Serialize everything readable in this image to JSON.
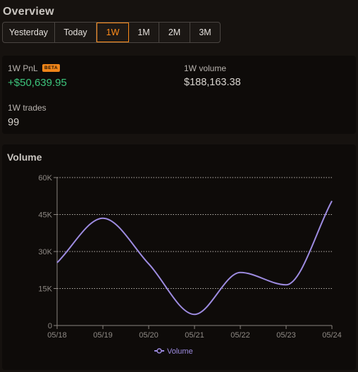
{
  "overview": {
    "title": "Overview",
    "tabs": [
      {
        "label": "Yesterday",
        "active": false
      },
      {
        "label": "Today",
        "active": false
      },
      {
        "label": "1W",
        "active": true
      },
      {
        "label": "1M",
        "active": false
      },
      {
        "label": "2M",
        "active": false
      },
      {
        "label": "3M",
        "active": false
      }
    ]
  },
  "stats": {
    "pnl_label": "1W PnL",
    "pnl_badge": "BETA",
    "pnl_value": "+$50,639.95",
    "volume_label": "1W volume",
    "volume_value": "$188,163.38",
    "trades_label": "1W trades",
    "trades_value": "99"
  },
  "colors": {
    "accent": "#ff8c1a",
    "positive": "#3cc47c",
    "series": "#9d8be0"
  },
  "chart_data": {
    "type": "line",
    "title": "Volume",
    "x": [
      "05/18",
      "05/19",
      "05/20",
      "05/21",
      "05/22",
      "05/23",
      "05/24"
    ],
    "series": [
      {
        "name": "Volume",
        "values": [
          25500,
          43500,
          25000,
          4500,
          21500,
          16500,
          50500
        ]
      }
    ],
    "ylim": [
      0,
      60000
    ],
    "yticks": [
      0,
      15000,
      30000,
      45000,
      60000
    ],
    "ytick_labels": [
      "0",
      "15K",
      "30K",
      "45K",
      "60K"
    ],
    "grid": "horizontal-dotted",
    "legend_position": "bottom"
  }
}
